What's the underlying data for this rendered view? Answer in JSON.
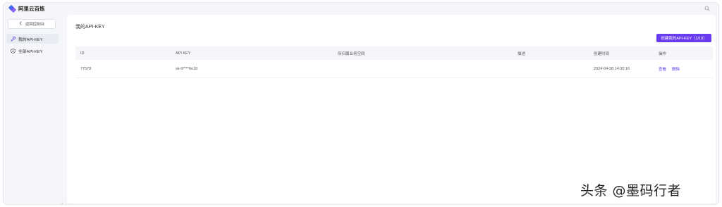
{
  "app": {
    "title": "阿里云百炼"
  },
  "sidebar": {
    "back_label": "返回控制台",
    "items": [
      {
        "label": "我的API-KEY",
        "icon": "key-icon",
        "active": true
      },
      {
        "label": "全部API-KEY",
        "icon": "shield-key-icon",
        "active": false
      }
    ]
  },
  "main": {
    "title": "我的API-KEY",
    "create_button": "创建我的API-KEY（1/10）",
    "table": {
      "headers": {
        "id": "ID",
        "key": "API KEY",
        "workspace": "所归属业务空间",
        "desc": "描述",
        "time": "创建时间",
        "ops": "操作"
      },
      "rows": [
        {
          "id": "77578",
          "key": "sk-6****6e18",
          "workspace": "",
          "desc": "",
          "time": "2024-04-28 14:30:16",
          "view": "查看",
          "delete": "删除"
        }
      ]
    }
  },
  "watermark": "头条 @墨码行者",
  "colors": {
    "accent": "#6a3cf0",
    "link": "#5b3df0"
  }
}
